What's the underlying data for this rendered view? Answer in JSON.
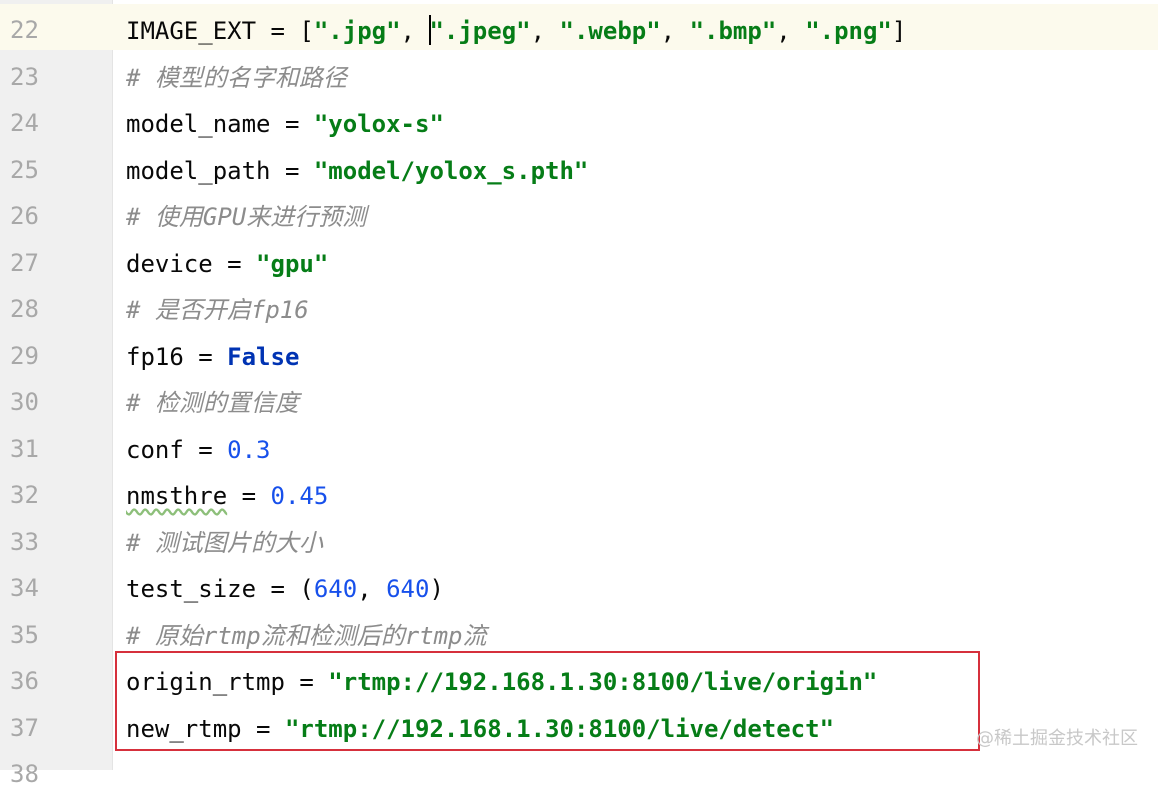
{
  "editor": {
    "lines": [
      {
        "num": "22",
        "tokens": [
          {
            "t": "IMAGE_EXT = [",
            "c": ""
          },
          {
            "t": "\".jpg\"",
            "c": "str"
          },
          {
            "t": ", ",
            "c": ""
          },
          {
            "t": "|",
            "c": "caret"
          },
          {
            "t": "\".jpeg\"",
            "c": "str"
          },
          {
            "t": ", ",
            "c": ""
          },
          {
            "t": "\".webp\"",
            "c": "str"
          },
          {
            "t": ", ",
            "c": ""
          },
          {
            "t": "\".bmp\"",
            "c": "str"
          },
          {
            "t": ", ",
            "c": ""
          },
          {
            "t": "\".png\"",
            "c": "str"
          },
          {
            "t": "]",
            "c": ""
          }
        ]
      },
      {
        "num": "23",
        "tokens": [
          {
            "t": "# 模型的名字和路径",
            "c": "cmt"
          }
        ]
      },
      {
        "num": "24",
        "tokens": [
          {
            "t": "model_name = ",
            "c": ""
          },
          {
            "t": "\"yolox-s\"",
            "c": "str"
          }
        ]
      },
      {
        "num": "25",
        "tokens": [
          {
            "t": "model_path = ",
            "c": ""
          },
          {
            "t": "\"model/yolox_s.pth\"",
            "c": "str"
          }
        ]
      },
      {
        "num": "26",
        "tokens": [
          {
            "t": "# 使用GPU来进行预测",
            "c": "cmt"
          }
        ]
      },
      {
        "num": "27",
        "tokens": [
          {
            "t": "device = ",
            "c": ""
          },
          {
            "t": "\"gpu\"",
            "c": "str"
          }
        ]
      },
      {
        "num": "28",
        "tokens": [
          {
            "t": "# 是否开启fp16",
            "c": "cmt"
          }
        ]
      },
      {
        "num": "29",
        "tokens": [
          {
            "t": "fp16 = ",
            "c": ""
          },
          {
            "t": "False",
            "c": "kw"
          }
        ]
      },
      {
        "num": "30",
        "tokens": [
          {
            "t": "# 检测的置信度",
            "c": "cmt"
          }
        ]
      },
      {
        "num": "31",
        "tokens": [
          {
            "t": "conf = ",
            "c": ""
          },
          {
            "t": "0.3",
            "c": "num"
          }
        ]
      },
      {
        "num": "32",
        "tokens": [
          {
            "t": "nmsthre",
            "c": "squig"
          },
          {
            "t": " = ",
            "c": ""
          },
          {
            "t": "0.45",
            "c": "num"
          }
        ]
      },
      {
        "num": "33",
        "tokens": [
          {
            "t": "# 测试图片的大小",
            "c": "cmt"
          }
        ]
      },
      {
        "num": "34",
        "tokens": [
          {
            "t": "test_size = (",
            "c": ""
          },
          {
            "t": "640",
            "c": "num"
          },
          {
            "t": ", ",
            "c": ""
          },
          {
            "t": "640",
            "c": "num"
          },
          {
            "t": ")",
            "c": ""
          }
        ]
      },
      {
        "num": "35",
        "tokens": [
          {
            "t": "# 原始rtmp流和检测后的rtmp流",
            "c": "cmt"
          }
        ]
      },
      {
        "num": "36",
        "tokens": [
          {
            "t": "origin_rtmp = ",
            "c": ""
          },
          {
            "t": "\"rtmp://192.168.1.30:8100/live/origin\"",
            "c": "str"
          }
        ]
      },
      {
        "num": "37",
        "tokens": [
          {
            "t": "new_rtmp = ",
            "c": ""
          },
          {
            "t": "\"rtmp://192.168.1.30:8100/live/detect\"",
            "c": "str"
          }
        ]
      },
      {
        "num": "38",
        "tokens": []
      }
    ],
    "current_line": "22"
  },
  "colors": {
    "string": "#067d17",
    "number": "#1750eb",
    "keyword": "#0033b3",
    "comment": "#8c8c8c",
    "highlight_box": "#d6303c",
    "current_line_bg": "#fcfaed"
  },
  "watermark": "@稀土掘金技术社区"
}
